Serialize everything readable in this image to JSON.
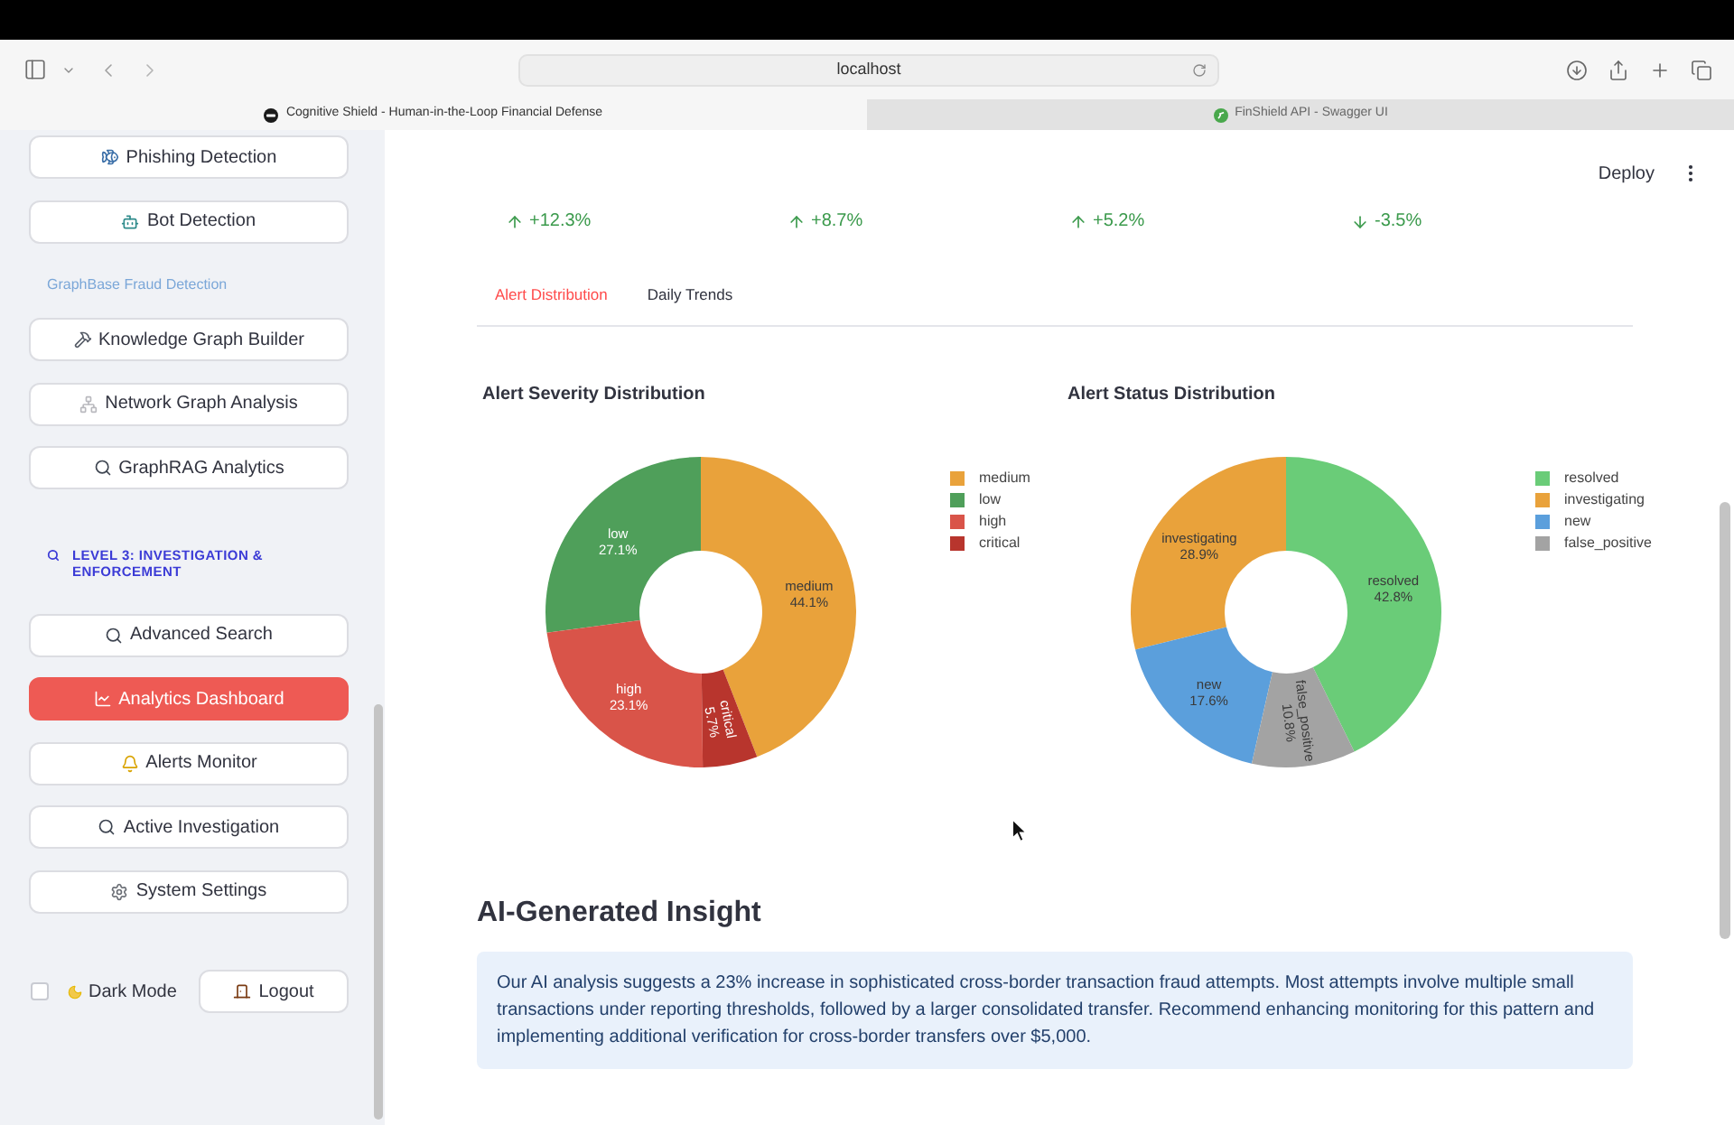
{
  "browser": {
    "address": "localhost",
    "tabs": [
      {
        "title": "Cognitive Shield - Human-in-the-Loop Financial Defense",
        "selected": true
      },
      {
        "title": "FinShield API - Swagger UI",
        "selected": false
      }
    ]
  },
  "sidebar": {
    "items": [
      {
        "kind": "button",
        "label": "Phishing Detection",
        "selected": false
      },
      {
        "kind": "button",
        "label": "Bot Detection",
        "selected": false
      },
      {
        "kind": "caption",
        "label": "GraphBase Fraud Detection"
      },
      {
        "kind": "button",
        "label": "Knowledge Graph Builder",
        "selected": false
      },
      {
        "kind": "button",
        "label": "Network Graph Analysis",
        "selected": false
      },
      {
        "kind": "button",
        "label": "GraphRAG Analytics",
        "selected": false
      },
      {
        "kind": "heading",
        "label": "LEVEL 3: INVESTIGATION & ENFORCEMENT"
      },
      {
        "kind": "button",
        "label": "Advanced Search",
        "selected": false
      },
      {
        "kind": "button",
        "label": "Analytics Dashboard",
        "selected": true
      },
      {
        "kind": "button",
        "label": "Alerts Monitor",
        "selected": false
      },
      {
        "kind": "button",
        "label": "Active Investigation",
        "selected": false
      },
      {
        "kind": "button",
        "label": "System Settings",
        "selected": false
      }
    ],
    "dark_mode": {
      "label": "Dark Mode",
      "checked": false
    },
    "logout": {
      "label": "Logout"
    }
  },
  "header": {
    "deploy": "Deploy"
  },
  "metrics": [
    {
      "delta": "+12.3%",
      "up": true
    },
    {
      "delta": "+8.7%",
      "up": true
    },
    {
      "delta": "+5.2%",
      "up": true
    },
    {
      "delta": "-3.5%",
      "up": false
    }
  ],
  "tabs": [
    {
      "label": "Alert Distribution",
      "selected": true
    },
    {
      "label": "Daily Trends",
      "selected": false
    }
  ],
  "charts": [
    {
      "legend": [
        {
          "label": "medium",
          "color": "#e9a23b"
        },
        {
          "label": "low",
          "color": "#4f9f5a"
        },
        {
          "label": "high",
          "color": "#d95449"
        },
        {
          "label": "critical",
          "color": "#b8352d"
        }
      ],
      "chart_data": {
        "type": "donut",
        "title": "Alert Severity Distribution",
        "categories": [
          "medium",
          "low",
          "high",
          "critical"
        ],
        "values": [
          44.1,
          27.1,
          23.1,
          5.7
        ],
        "value_labels": [
          "44.1%",
          "27.1%",
          "23.1%",
          "5.7%"
        ]
      }
    },
    {
      "legend": [
        {
          "label": "resolved",
          "color": "#6acc78"
        },
        {
          "label": "investigating",
          "color": "#e9a23b"
        },
        {
          "label": "new",
          "color": "#5b9fdc"
        },
        {
          "label": "false_positive",
          "color": "#a3a3a3"
        }
      ],
      "chart_data": {
        "type": "donut",
        "title": "Alert Status Distribution",
        "categories": [
          "resolved",
          "investigating",
          "new",
          "false_positive"
        ],
        "values": [
          42.8,
          28.9,
          17.6,
          10.8
        ],
        "value_labels": [
          "42.8%",
          "28.9%",
          "17.6%",
          "10.8%"
        ]
      }
    }
  ],
  "insight": {
    "title": "AI-Generated Insight",
    "text": "Our AI analysis suggests a 23% increase in sophisticated cross-border transaction fraud attempts. Most attempts involve multiple small transactions under reporting thresholds, followed by a larger consolidated transfer. Recommend enhancing monitoring for this pattern and implementing additional verification for cross-border transfers over $5,000."
  }
}
